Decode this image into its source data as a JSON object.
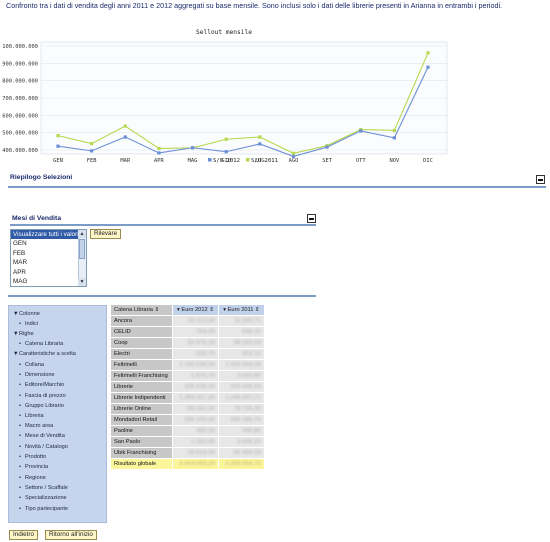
{
  "header": {
    "intro_text": "Confronto tra i dati di vendita degli anni 2011 e 2012 aggregati su base mensile. Sono inclusi solo i dati delle librerie presenti in Arianna in entrambi i periodi."
  },
  "chart_data": {
    "type": "line",
    "title": "Sellout mensile",
    "categories": [
      "GEN",
      "FEB",
      "MAR",
      "APR",
      "MAG",
      "GIU",
      "LUG",
      "AGO",
      "SET",
      "OTT",
      "NOV",
      "DIC"
    ],
    "y_ticks": [
      "100.000.000",
      "900.000.000",
      "800.000.000",
      "700.000.000",
      "600.000.000",
      "500.000.000",
      "400.000.000"
    ],
    "y_tick_values": [
      1000000000,
      900000000,
      800000000,
      700000000,
      600000000,
      500000000,
      400000000
    ],
    "ylim": [
      400000000,
      1000000000
    ],
    "grid": true,
    "legend_position": "bottom",
    "series": [
      {
        "name": "S/O 2012",
        "color": "#6c8fd6",
        "values": [
          422000000,
          395000000,
          475000000,
          383000000,
          413000000,
          390000000,
          435000000,
          363000000,
          417000000,
          510000000,
          470000000,
          878000000
        ]
      },
      {
        "name": "S/O 2011",
        "color": "#b5d94e",
        "values": [
          483000000,
          437000000,
          538000000,
          409000000,
          412000000,
          462000000,
          475000000,
          381000000,
          425000000,
          518000000,
          513000000,
          960000000
        ]
      }
    ]
  },
  "riepilogo": {
    "title": "Riepilogo Selezioni"
  },
  "mesi": {
    "title": "Mesi di Vendita",
    "list_header": "Visualizzare tutti i valori",
    "options": [
      "GEN",
      "FEB",
      "MAR",
      "APR",
      "MAG"
    ],
    "rilevare_button": "Rilevare"
  },
  "nav": {
    "items": [
      {
        "text": "Colonne",
        "bullet": "▼",
        "level": 0
      },
      {
        "text": "Indici",
        "bullet": "•",
        "level": 1
      },
      {
        "text": "Righe",
        "bullet": "▼",
        "level": 0
      },
      {
        "text": "Catena Libraria",
        "bullet": "•",
        "level": 1
      },
      {
        "text": "Caratteristiche a scelta",
        "bullet": "▼",
        "level": 0
      },
      {
        "text": "Collana",
        "bullet": "•",
        "level": 1
      },
      {
        "text": "Dimensione",
        "bullet": "•",
        "level": 1
      },
      {
        "text": "Editore/Marchio",
        "bullet": "•",
        "level": 1
      },
      {
        "text": "Fascia di prezzo",
        "bullet": "•",
        "level": 1
      },
      {
        "text": "Gruppo Librario",
        "bullet": "•",
        "level": 1
      },
      {
        "text": "Libreria",
        "bullet": "•",
        "level": 1
      },
      {
        "text": "Macro area",
        "bullet": "•",
        "level": 1
      },
      {
        "text": "Mese di Vendita",
        "bullet": "•",
        "level": 1
      },
      {
        "text": "Novità / Catalogo",
        "bullet": "•",
        "level": 1
      },
      {
        "text": "Prodotto",
        "bullet": "•",
        "level": 1
      },
      {
        "text": "Provincia",
        "bullet": "•",
        "level": 1
      },
      {
        "text": "Regione",
        "bullet": "•",
        "level": 1
      },
      {
        "text": "Settore / Scaffale",
        "bullet": "•",
        "level": 1
      },
      {
        "text": "Specializzazione",
        "bullet": "•",
        "level": 1
      },
      {
        "text": "Tipo partecipante",
        "bullet": "•",
        "level": 1
      }
    ]
  },
  "table": {
    "col_headers": [
      "Catena Libraria ⇕",
      "▾ Euro 2012 ⇕",
      "▾ Euro 2011 ⇕"
    ],
    "rows": [
      {
        "label": "Ancora",
        "v2012": "16.213,30",
        "v2011": "11.320,71"
      },
      {
        "label": "CELID",
        "v2012": "764,25",
        "v2011": "549,15"
      },
      {
        "label": "Coop",
        "v2012": "91.975,18",
        "v2011": "98.283,69"
      },
      {
        "label": "Electri",
        "v2012": "518,75",
        "v2011": "423,10"
      },
      {
        "label": "Feltrinelli",
        "v2012": "1.742.030,09",
        "v2011": "1.925.659,29"
      },
      {
        "label": "Feltrinelli Franchising",
        "v2012": "2.879,79",
        "v2011": "3.043,80"
      },
      {
        "label": "Librerie",
        "v2012": "325.638,26",
        "v2011": "263.438,59"
      },
      {
        "label": "Librerie Indipendenti",
        "v2012": "1.389.327,20",
        "v2011": "1.249.997,71"
      },
      {
        "label": "Librerie Online",
        "v2012": "80.352,26",
        "v2011": "79.755,30"
      },
      {
        "label": "Mondadori Retail",
        "v2012": "295.163,42",
        "v2011": "285.185,76"
      },
      {
        "label": "Paoline",
        "v2012": "482,39",
        "v2011": "345,80"
      },
      {
        "label": "San Paolo",
        "v2012": "2.323,45",
        "v2011": "3.436,20"
      },
      {
        "label": "Ubik Franchising",
        "v2012": "15.619,26",
        "v2011": "65.465,53"
      }
    ],
    "total": {
      "label": "Risultato globale",
      "v2012": "3.414.552,24",
      "v2011": "3.255.054,72"
    }
  },
  "footer": {
    "back_button": "Indietro",
    "home_button": "Ritorno all'inizio"
  }
}
